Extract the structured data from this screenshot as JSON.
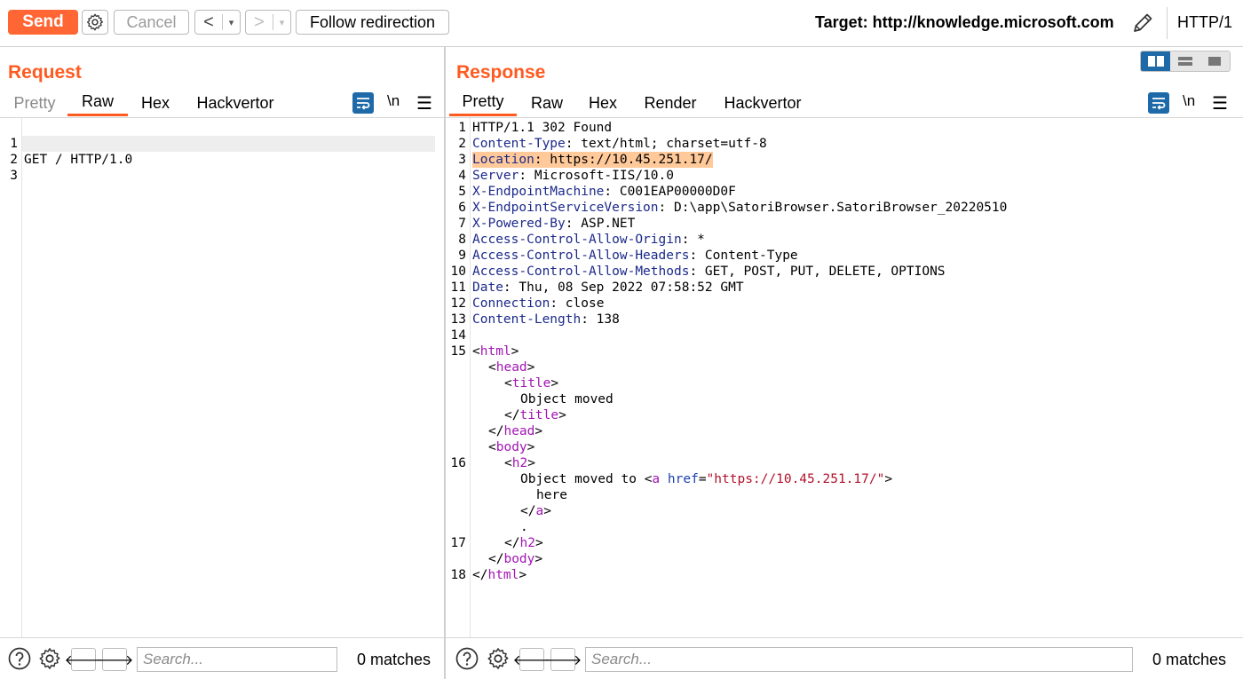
{
  "toolbar": {
    "send_label": "Send",
    "cancel_label": "Cancel",
    "back_glyph": "<",
    "forward_glyph": ">",
    "dropdown_glyph": "▾",
    "follow_label": "Follow redirection",
    "target_text": "Target: http://knowledge.microsoft.com",
    "protocol": "HTTP/1"
  },
  "request": {
    "title": "Request",
    "tabs": [
      "Pretty",
      "Raw",
      "Hex",
      "Hackvertor"
    ],
    "newline_label": "\\n",
    "lines": [
      "GET / HTTP/1.0",
      "",
      ""
    ],
    "line_numbers": [
      "1",
      "2",
      "3"
    ],
    "search_placeholder": "Search...",
    "matches": "0 matches"
  },
  "response": {
    "title": "Response",
    "tabs": [
      "Pretty",
      "Raw",
      "Hex",
      "Render",
      "Hackvertor"
    ],
    "newline_label": "\\n",
    "status_line": "HTTP/1.1 302 Found",
    "headers": [
      {
        "name": "Content-Type",
        "value": " text/html; charset=utf-8"
      },
      {
        "name": "Location",
        "value": " https://10.45.251.17/"
      },
      {
        "name": "Server",
        "value": " Microsoft-IIS/10.0"
      },
      {
        "name": "X-EndpointMachine",
        "value": " C001EAP00000D0F"
      },
      {
        "name": "X-EndpointServiceVersion",
        "value": " D:\\app\\SatoriBrowser.SatoriBrowser_20220510"
      },
      {
        "name": "X-Powered-By",
        "value": " ASP.NET"
      },
      {
        "name": "Access-Control-Allow-Origin",
        "value": " *"
      },
      {
        "name": "Access-Control-Allow-Headers",
        "value": " Content-Type"
      },
      {
        "name": "Access-Control-Allow-Methods",
        "value": " GET, POST, PUT, DELETE, OPTIONS"
      },
      {
        "name": "Date",
        "value": " Thu, 08 Sep 2022 07:58:52 GMT"
      },
      {
        "name": "Connection",
        "value": " close"
      },
      {
        "name": "Content-Length",
        "value": " 138"
      }
    ],
    "line_numbers": [
      "1",
      "2",
      "3",
      "4",
      "5",
      "6",
      "7",
      "8",
      "9",
      "10",
      "11",
      "12",
      "13",
      "14",
      "15",
      "",
      "",
      "",
      "",
      "",
      "",
      "16",
      "",
      "",
      "",
      "",
      "17",
      "",
      "18"
    ],
    "body": {
      "tag_html": "html",
      "tag_head": "head",
      "tag_title": "title",
      "title_text": "Object moved",
      "tag_body": "body",
      "tag_h2": "h2",
      "moved_text": "Object moved to ",
      "tag_a": "a",
      "attr_href": "href",
      "href_value": "\"https://10.45.251.17/\"",
      "link_text": "here",
      "period": "."
    },
    "search_placeholder": "Search...",
    "matches": "0 matches"
  },
  "colors": {
    "accent": "#ff6633",
    "title": "#ff5a1f",
    "header_name": "#1c2a8a",
    "tag": "#a316b5",
    "highlight": "#ffc99a",
    "toggle_active": "#1e6aa8"
  }
}
